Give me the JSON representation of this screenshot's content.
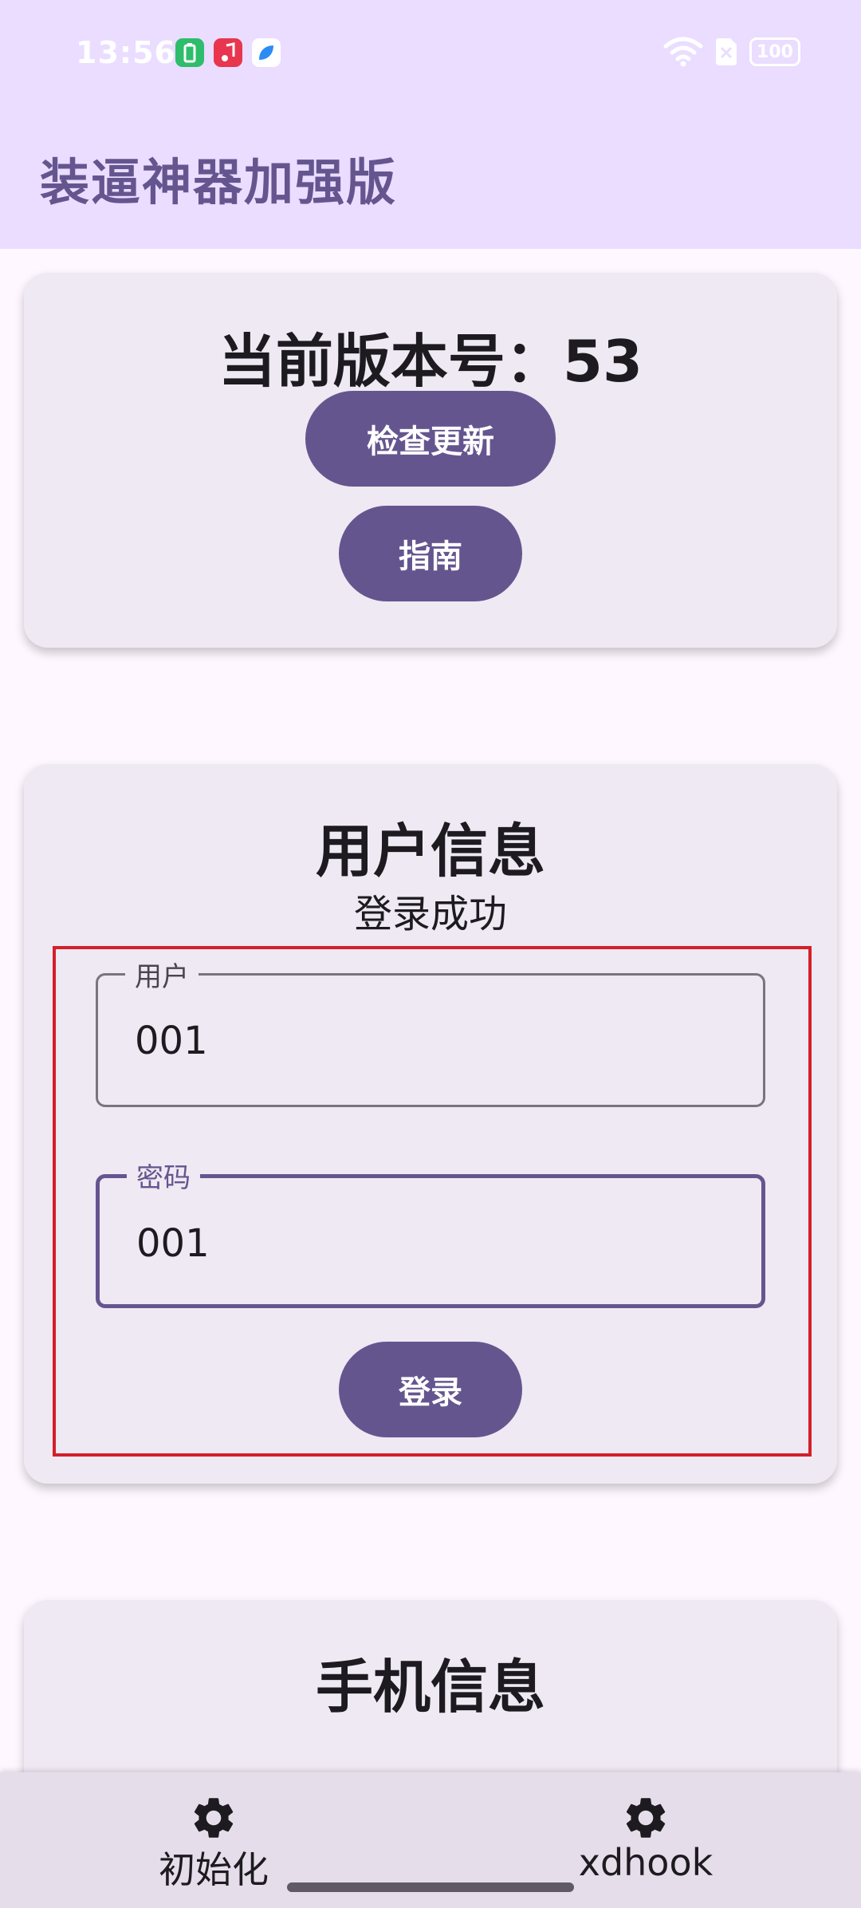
{
  "status_bar": {
    "time": "13:56",
    "battery": "100"
  },
  "app_bar": {
    "title": "装逼神器加强版"
  },
  "version_card": {
    "version_text": "当前版本号：53",
    "check_update_label": "检查更新",
    "guide_label": "指南"
  },
  "user_card": {
    "title": "用户信息",
    "status": "登录成功",
    "user_field": {
      "label": "用户",
      "value": "001"
    },
    "password_field": {
      "label": "密码",
      "value": "001"
    },
    "login_label": "登录"
  },
  "phone_card": {
    "title": "手机信息"
  },
  "bottom_nav": {
    "items": [
      {
        "label": "初始化",
        "icon": "gear-icon"
      },
      {
        "label": "xdhook",
        "icon": "gear-icon"
      }
    ]
  },
  "colors": {
    "primary": "#65558F",
    "topbar": "#EADDFF",
    "card": "#EFE9F3",
    "highlight": "#D3202A"
  }
}
